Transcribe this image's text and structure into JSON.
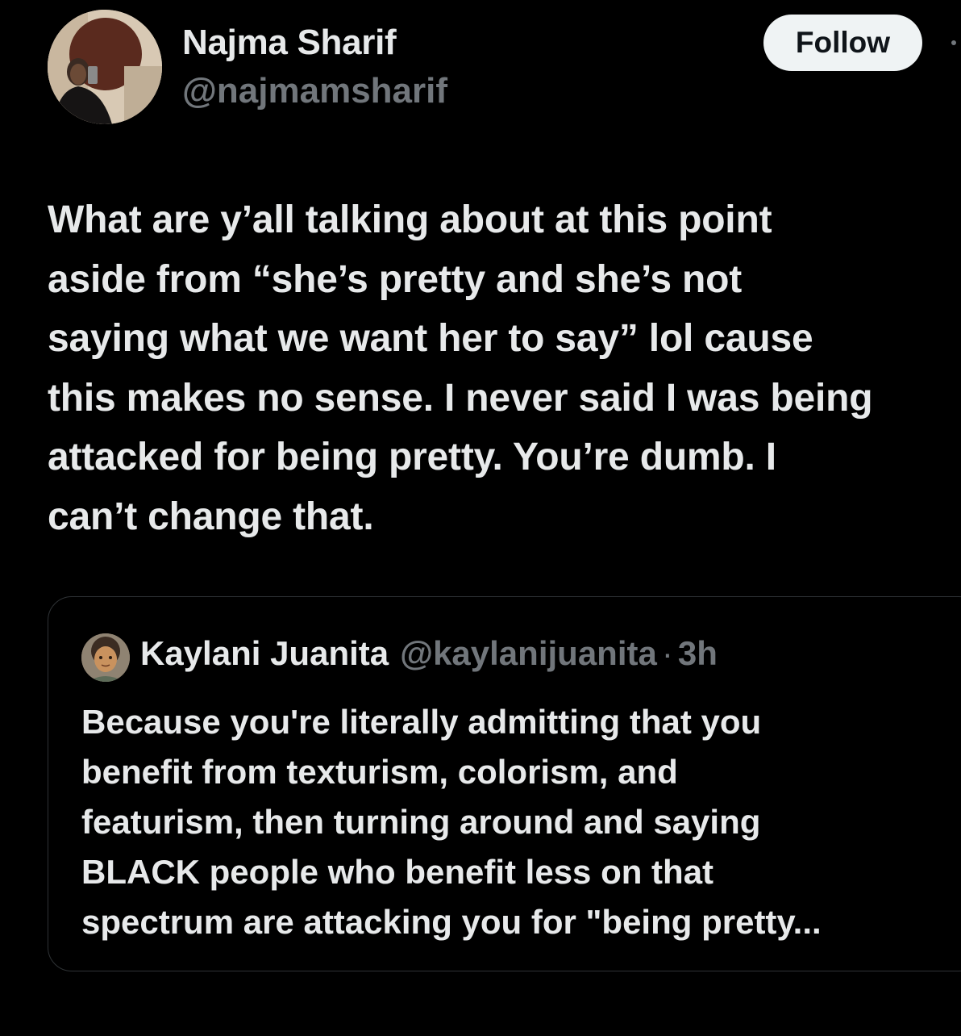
{
  "author": {
    "name": "Najma Sharif",
    "handle": "@najmamsharif",
    "follow_label": "Follow",
    "avatar_icon": "profile-photo-icon"
  },
  "more_icon": "more-dots-icon",
  "tweet": {
    "text": "What are y’all talking about at this point\naside from “she’s pretty and she’s not\nsaying what we want her to say” lol cause\nthis makes no sense. I never said I was being\nattacked for being pretty. You’re dumb. I\ncan’t change that."
  },
  "quoted_tweet": {
    "name": "Kaylani Juanita",
    "handle": "@kaylanijuanita",
    "separator": "·",
    "time": "3h",
    "avatar_icon": "profile-illustration-icon",
    "text": "Because you're literally admitting that you\nbenefit from texturism, colorism, and\nfeaturism, then turning around and saying\nBLACK people who benefit less on that\nspectrum are attacking you for \"being pretty..."
  },
  "colors": {
    "background": "#000000",
    "primary_text": "#e7e9ea",
    "secondary_text": "#71767b",
    "follow_bg": "#eff3f4",
    "border": "#2f3336"
  }
}
